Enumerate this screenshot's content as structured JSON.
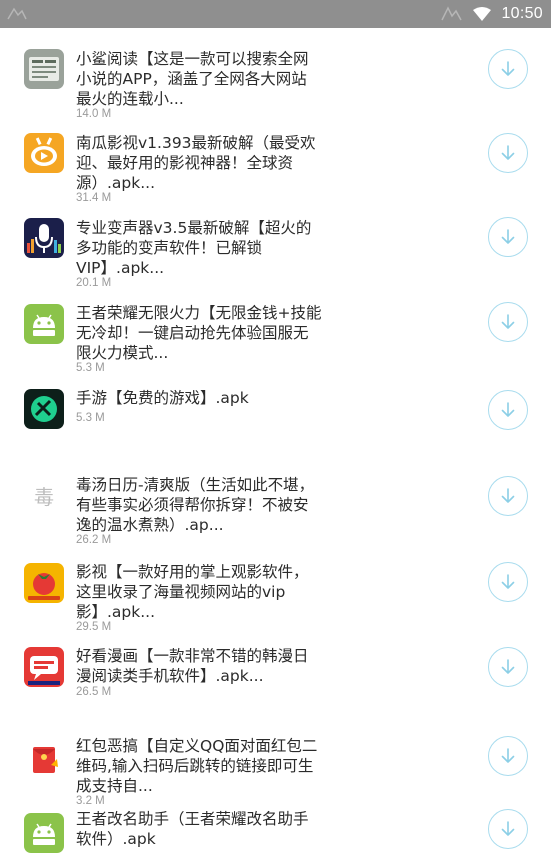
{
  "status_bar": {
    "time": "10:50",
    "icons": [
      "watermark-icon",
      "wifi-icon"
    ]
  },
  "accent_color": "#a9dcee",
  "apps": [
    {
      "title": "小鲨阅读【这是一款可以搜索全网\n小说的APP，涵盖了全网各大网站\n最火的连载小...",
      "size": "14.0 M",
      "icon": "book-reader-icon"
    },
    {
      "title": "南瓜影视v1.393最新破解（最受欢\n迎、最好用的影视神器！全球资\n源）.apk...",
      "size": "31.4 M",
      "icon": "video-player-icon"
    },
    {
      "title": "专业变声器v3.5最新破解【超火的\n多功能的变声软件！已解锁\nVIP】.apk...",
      "size": "20.1 M",
      "icon": "microphone-icon"
    },
    {
      "title": "王者荣耀无限火力【无限金钱+技能\n无冷却！一键启动抢先体验国服无\n限火力模式...",
      "size": "5.3 M",
      "icon": "android-icon"
    },
    {
      "title": "手游【免费的游戏】.apk",
      "size": "5.3 M",
      "icon": "game-logo-icon"
    },
    {
      "title": "毒汤日历-清爽版（生活如此不堪，\n有些事实必须得帮你拆穿！不被安\n逸的温水煮熟）.ap...",
      "size": "26.2 M",
      "icon": "calendar-glyph-icon"
    },
    {
      "title": "影视【一款好用的掌上观影软件，\n这里收录了海量视频网站的vip\n影】.apk...",
      "size": "29.5 M",
      "icon": "tomato-icon"
    },
    {
      "title": "好看漫画【一款非常不错的韩漫日\n漫阅读类手机软件】.apk...",
      "size": "26.5 M",
      "icon": "comic-icon"
    },
    {
      "title": "红包恶搞【自定义QQ面对面红包二\n维码,输入扫码后跳转的链接即可生\n成支持自...",
      "size": "3.2 M",
      "icon": "red-envelope-icon"
    },
    {
      "title": "王者改名助手（王者荣耀改名助手\n软件）.apk",
      "size": "",
      "icon": "android-icon"
    }
  ]
}
